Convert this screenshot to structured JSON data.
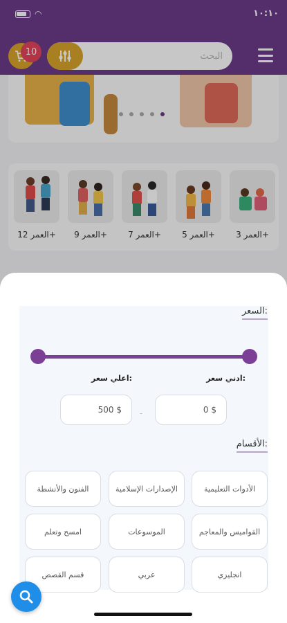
{
  "status_bar": {
    "time": "١٠:١٠"
  },
  "header": {
    "cart_count": "10",
    "search_placeholder": "البحث",
    "icons": [
      "cart-icon",
      "filter-sliders-icon",
      "menu-icon"
    ]
  },
  "banner": {
    "slide_count": 5,
    "active_slide": 5
  },
  "age_groups": [
    {
      "label": "العمر 3+"
    },
    {
      "label": "العمر 5+"
    },
    {
      "label": "العمر 7+"
    },
    {
      "label": "العمر 9+"
    },
    {
      "label": "العمر 12+"
    }
  ],
  "filter_sheet": {
    "price_title": "السعر:",
    "min_price_label": "ادني سعر:",
    "max_price_label": "اعلي سعر:",
    "min_price_value": "0 $",
    "max_price_value": "500 $",
    "separator": "-",
    "categories_title": "الأقسام:",
    "categories": [
      {
        "label": "الأدوات التعليمية"
      },
      {
        "label": "الإصدارات الإسلامية"
      },
      {
        "label": "الفنون والأنشطة"
      },
      {
        "label": "القواميس والمعاجم"
      },
      {
        "label": "الموسوعات"
      },
      {
        "label": "امسح وتعلم"
      },
      {
        "label": "انجليزي"
      },
      {
        "label": "عربي"
      },
      {
        "label": "قسم القصص"
      }
    ]
  },
  "colors": {
    "brand": "#6c3a8a",
    "accent": "#d9a52b",
    "badge": "#e0455c",
    "fab": "#1f8ee8"
  }
}
